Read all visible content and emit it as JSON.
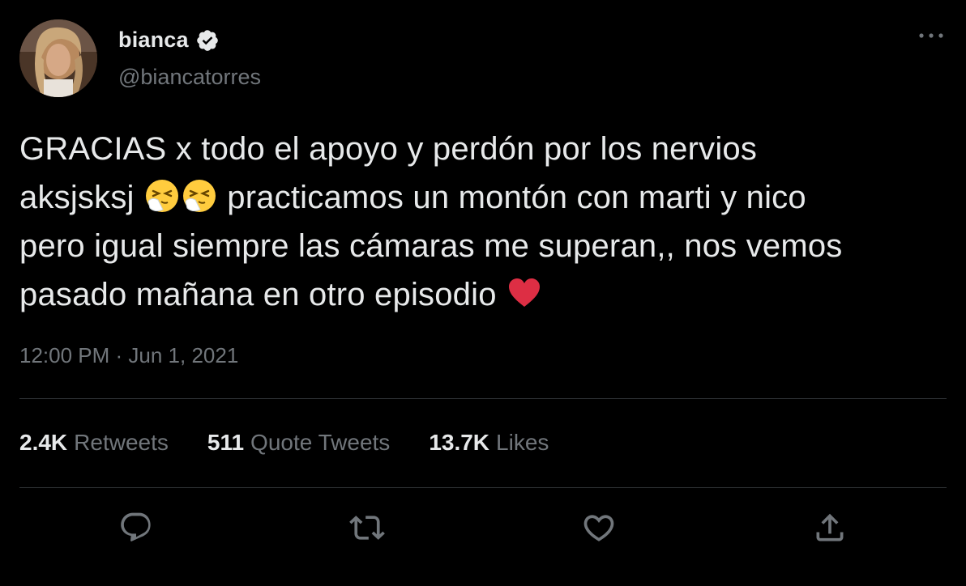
{
  "author": {
    "display_name": "bianca",
    "handle": "@biancatorres",
    "verified_icon": "verified-badge-icon"
  },
  "tweet": {
    "lines": [
      {
        "text": "GRACIAS x todo el apoyo y perdón por los nervios"
      },
      {
        "before": "aksjsksj ",
        "after": "  practicamos un montón con marti y nico"
      },
      {
        "text": "pero igual siempre las cámaras me superan,, nos vemos"
      },
      {
        "text": "pasado mañana en otro episodio "
      }
    ],
    "emojis": [
      "sneezing-face-emoji",
      "sneezing-face-emoji",
      "red-heart-emoji"
    ],
    "timestamp": "12:00 PM · Jun 1, 2021"
  },
  "stats": {
    "retweets": {
      "count": "2.4K",
      "label": "Retweets"
    },
    "quote_tweets": {
      "count": "511",
      "label": "Quote Tweets"
    },
    "likes": {
      "count": "13.7K",
      "label": "Likes"
    }
  },
  "actions": [
    "reply-icon",
    "retweet-icon",
    "like-icon",
    "share-icon"
  ],
  "colors": {
    "background": "#000000",
    "text_primary": "#e7e9ea",
    "text_secondary": "#71767b",
    "divider": "#2f3336"
  }
}
